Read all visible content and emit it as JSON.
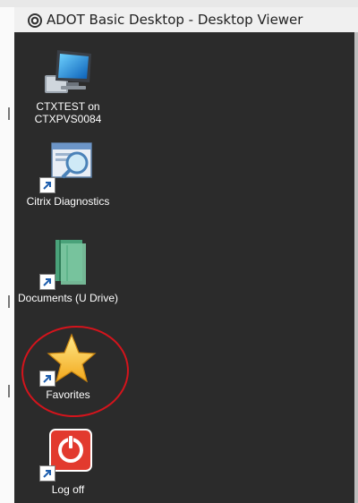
{
  "window": {
    "title": "ADOT Basic Desktop - Desktop Viewer"
  },
  "icons": [
    {
      "label": "CTXTEST on CTXPVS0084",
      "icon": "computer-icon"
    },
    {
      "label": "Citrix Diagnostics",
      "icon": "citrix-diagnostics-icon"
    },
    {
      "label": "Documents (U Drive)",
      "icon": "documents-drive-icon"
    },
    {
      "label": "Favorites",
      "icon": "favorites-star-icon"
    },
    {
      "label": "Log off",
      "icon": "log-off-icon"
    }
  ],
  "annotation": {
    "color": "#d4141c"
  }
}
